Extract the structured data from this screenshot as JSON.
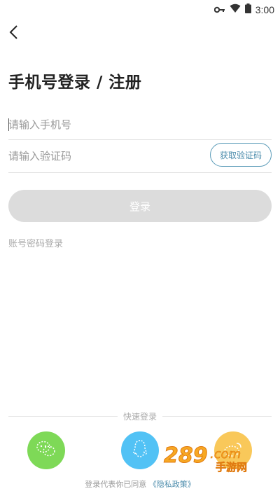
{
  "status_bar": {
    "time": "3:00",
    "icons": [
      "key-icon",
      "wifi-icon",
      "battery-icon"
    ]
  },
  "header": {
    "back_icon": "chevron-left-icon",
    "title": "手机号登录 / 注册"
  },
  "form": {
    "phone_placeholder": "请输入手机号",
    "phone_value": "",
    "code_placeholder": "请输入验证码",
    "code_value": "",
    "get_code_label": "获取验证码",
    "login_label": "登录",
    "password_login_label": "账号密码登录"
  },
  "quick_login": {
    "label": "快速登录",
    "options": [
      {
        "name": "wechat",
        "icon": "wechat-icon",
        "color": "#7ed957"
      },
      {
        "name": "qq",
        "icon": "qq-icon",
        "color": "#52c2f5"
      },
      {
        "name": "weibo",
        "icon": "weibo-icon",
        "color": "#f9c85a"
      }
    ]
  },
  "agreement": {
    "prefix": "登录代表你已同意",
    "link": "《隐私政策》"
  },
  "watermark": {
    "logo_text": "289.com",
    "sub_text": "手游网"
  },
  "colors": {
    "accent": "#4a8bab",
    "disabled_button": "#dcdcdc",
    "title": "#222222",
    "placeholder": "#999999"
  }
}
